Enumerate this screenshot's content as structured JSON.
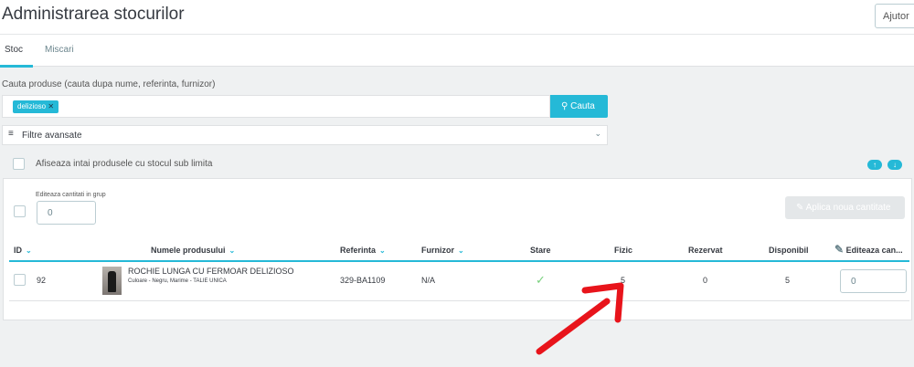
{
  "header": {
    "title": "Administrarea stocurilor",
    "help_label": "Ajutor"
  },
  "tabs": [
    {
      "label": "Stoc",
      "active": true
    },
    {
      "label": "Miscari",
      "active": false
    }
  ],
  "search": {
    "label": "Cauta produse (cauta dupa nume, referinta, furnizor)",
    "tags": [
      "delizioso"
    ],
    "button_label": "Cauta"
  },
  "filters": {
    "label": "Filtre avansate"
  },
  "low_stock_first": {
    "label": "Afiseaza intai produsele cu stocul sub limita",
    "checked": false
  },
  "bulk": {
    "label": "Editeaza cantitati in grup",
    "value": "0",
    "apply_label": "Aplica noua cantitate"
  },
  "table": {
    "headers": [
      "ID",
      "Numele produsului",
      "Referinta",
      "Furnizor",
      "Stare",
      "Fizic",
      "Rezervat",
      "Disponibil",
      "Editeaza can..."
    ],
    "rows": [
      {
        "id": "92",
        "name": "ROCHIE LUNGA CU FERMOAR DELIZIOSO",
        "attributes": "Culoare - Negru, Marime - TALIE UNICA",
        "reference": "329-BA1109",
        "supplier": "N/A",
        "status": "ok",
        "physical": "5",
        "reserved": "0",
        "available": "5",
        "edit_qty": "0"
      }
    ]
  },
  "colors": {
    "accent": "#25b9d7",
    "annotation": "#e8141b"
  }
}
